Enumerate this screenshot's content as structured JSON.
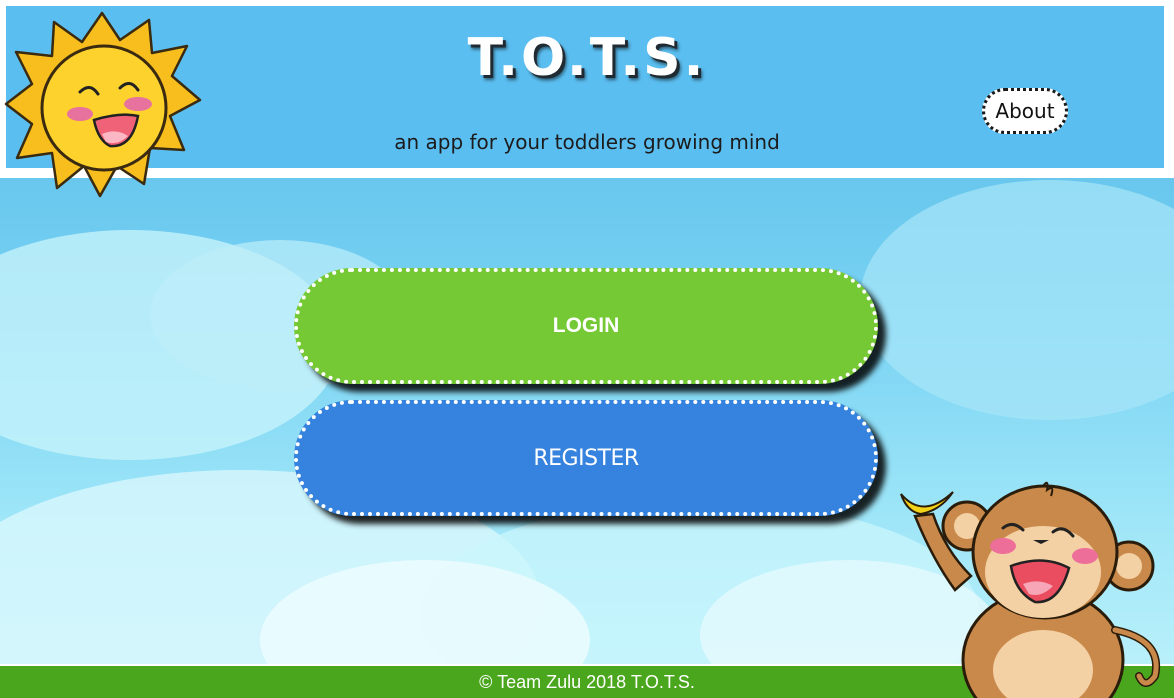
{
  "header": {
    "title": "T.O.T.S.",
    "tagline": "an app for your toddlers growing mind",
    "about_label": "About"
  },
  "main": {
    "login_label": "LOGIN",
    "register_label": "REGISTER"
  },
  "footer": {
    "copyright": "© Team Zulu 2018 T.O.T.S."
  },
  "colors": {
    "header_bg": "#5bbef0",
    "login_green": "#74c934",
    "register_blue": "#3583de",
    "footer_green": "#4aa61c"
  },
  "icons": {
    "sun": "sun-mascot-icon",
    "monkey": "monkey-mascot-icon"
  }
}
